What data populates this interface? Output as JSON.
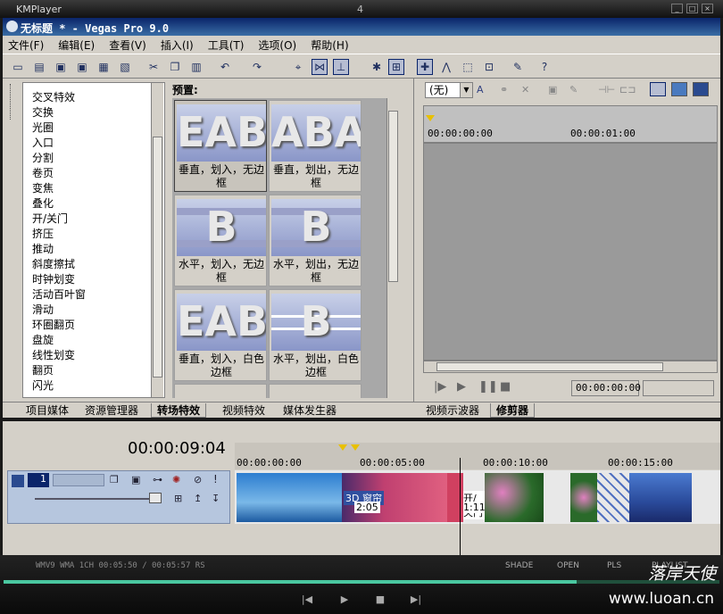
{
  "km_title": {
    "app": "KMPlayer",
    "number": "4",
    "buttons": [
      "_",
      "□",
      "×"
    ]
  },
  "vegas_title": "无标题 * - Vegas Pro 9.0",
  "menu": [
    "文件(F)",
    "编辑(E)",
    "查看(V)",
    "插入(I)",
    "工具(T)",
    "选项(O)",
    "帮助(H)"
  ],
  "transitions": [
    "交叉特效",
    "交换",
    "光圈",
    "入口",
    "分割",
    "卷页",
    "变焦",
    "叠化",
    "开/关门",
    "挤压",
    "推动",
    "斜度擦拭",
    "时钟划变",
    "活动百叶窗",
    "滑动",
    "环圈翻页",
    "盘旋",
    "线性划变",
    "翻页",
    "闪光"
  ],
  "presets_label": "预置:",
  "presets": [
    {
      "label": "垂直，划入，无边框",
      "glyph": "EAB"
    },
    {
      "label": "垂直，划出，无边框",
      "glyph": "ABA"
    },
    {
      "label": "水平，划入，无边框",
      "glyph": "B"
    },
    {
      "label": "水平，划出，无边框",
      "glyph": "B"
    },
    {
      "label": "垂直，划入，白色边框",
      "glyph": "EAB"
    },
    {
      "label": "水平，划出，白色边框",
      "glyph": "B"
    }
  ],
  "left_tabs": [
    "项目媒体",
    "资源管理器",
    "转场特效",
    "视频特效",
    "媒体发生器"
  ],
  "right": {
    "dropdown": "(无)",
    "ruler_start": "00:00:00:00",
    "ruler_mid": "00:00:01:00",
    "time_display": "00:00:00:00",
    "tabs": [
      "视频示波器",
      "修剪器"
    ]
  },
  "timeline": {
    "current_time": "00:00:09:04",
    "ruler": [
      "00:00:00:00",
      "00:00:05:00",
      "00:00:10:00",
      "00:00:15:00"
    ],
    "track_number": "1",
    "clip_label1": "3D 窗帘",
    "clip_time1": "2:05",
    "clip_label2": "开/关门",
    "clip_time2": "1:11"
  },
  "km_bottom": {
    "info": "WMV9 WMA 1CH 00:05:50 / 00:05:57 RS",
    "shade": "SHADE",
    "open": "OPEN",
    "pls": "PLS",
    "playlist": "PLAYLIST"
  },
  "watermark": {
    "text": "落岸天使",
    "url": "www.luoan.cn"
  },
  "colors": {
    "title_bar": "#0a246a",
    "panel": "#d4d0c8",
    "track": "#b6c6de"
  }
}
